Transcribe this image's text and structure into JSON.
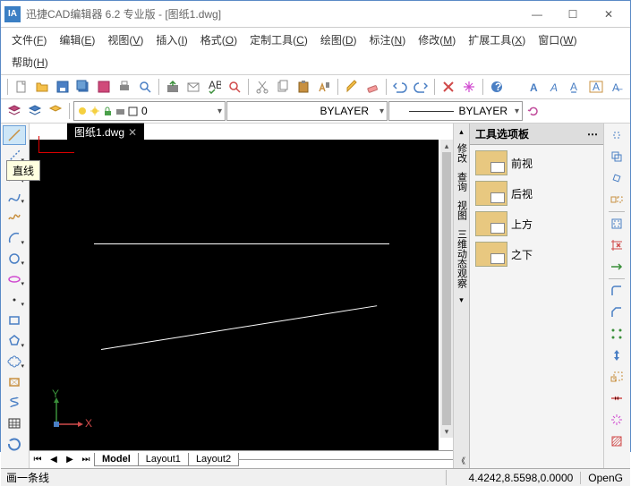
{
  "window": {
    "title": "迅捷CAD编辑器 6.2 专业版  - [图纸1.dwg]"
  },
  "menu": {
    "file": "文件",
    "file_u": "F",
    "edit": "编辑",
    "edit_u": "E",
    "view": "视图",
    "view_u": "V",
    "insert": "插入",
    "insert_u": "I",
    "format": "格式",
    "format_u": "O",
    "custom": "定制工具",
    "custom_u": "C",
    "draw": "绘图",
    "draw_u": "D",
    "dim": "标注",
    "dim_u": "N",
    "modify": "修改",
    "modify_u": "M",
    "ext": "扩展工具",
    "ext_u": "X",
    "window": "窗口",
    "window_u": "W",
    "help": "帮助",
    "help_u": "H"
  },
  "tabs": {
    "doc1": "图纸1.dwg",
    "model": "Model",
    "layout1": "Layout1",
    "layout2": "Layout2"
  },
  "layers": {
    "current": "0",
    "linetype1": "BYLAYER",
    "linetype2": "BYLAYER"
  },
  "palette": {
    "title": "工具选项板",
    "items": [
      "前视",
      "后视",
      "上方",
      "之下"
    ]
  },
  "sidebar": {
    "labels": [
      "修改",
      "查询",
      "视图",
      "三维动态观察"
    ]
  },
  "status": {
    "prompt": "画一条线",
    "coords": "4.4242,8.5598,0.0000",
    "gl": "OpenG"
  },
  "tooltip": "直线",
  "ucs": {
    "x": "X",
    "y": "Y"
  }
}
